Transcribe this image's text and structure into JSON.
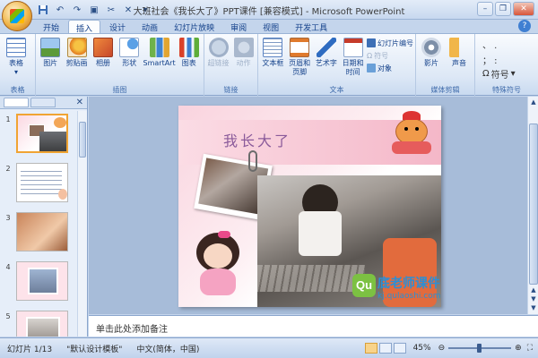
{
  "window": {
    "title": "大班社会《我长大了》PPT课件 [兼容模式] - Microsoft PowerPoint"
  },
  "qat": {
    "save_icon": "save-icon",
    "undo_icon": "undo-icon",
    "redo_icon": "redo-icon"
  },
  "tabs": [
    {
      "label": "开始"
    },
    {
      "label": "插入"
    },
    {
      "label": "设计"
    },
    {
      "label": "动画"
    },
    {
      "label": "幻灯片放映"
    },
    {
      "label": "审阅"
    },
    {
      "label": "视图"
    },
    {
      "label": "开发工具"
    }
  ],
  "active_tab": "插入",
  "ribbon": {
    "table_group": {
      "label": "表格",
      "table_btn": "表格"
    },
    "illustrations_group": {
      "label": "插图",
      "picture": "图片",
      "clipart": "剪贴画",
      "album": "相册",
      "shapes": "形状",
      "smartart": "SmartArt",
      "chart": "图表"
    },
    "links_group": {
      "label": "链接",
      "hyperlink": "超链接",
      "action": "动作"
    },
    "text_group": {
      "label": "文本",
      "textbox": "文本框",
      "header_footer_1": "页眉和",
      "header_footer_2": "页脚",
      "wordart": "艺术字",
      "datetime_1": "日期和",
      "datetime_2": "时间",
      "slide_number": "幻灯片编号",
      "symbol": "符号",
      "object": "对象"
    },
    "media_group": {
      "label": "媒体剪辑",
      "movie": "影片",
      "sound": "声音"
    },
    "special_group": {
      "label": "特殊符号",
      "symbol": "符号"
    }
  },
  "slides": [
    {
      "number": "1"
    },
    {
      "number": "2"
    },
    {
      "number": "3"
    },
    {
      "number": "4"
    },
    {
      "number": "5"
    }
  ],
  "slide": {
    "title": "我长大了",
    "watermark_cn": "底老师课件",
    "watermark_url": "kj.qulaoshi.com"
  },
  "notes": {
    "placeholder": "单击此处添加备注"
  },
  "status": {
    "slide_info": "幻灯片 1/13",
    "template": "\"默认设计模板\"",
    "language": "中文(简体，中国)",
    "zoom": "45%",
    "zoom_fraction": 0.45
  },
  "colors": {
    "accent": "#f0a433",
    "ribbon_text": "#15428b",
    "slide_pink": "#f7c6d3"
  }
}
